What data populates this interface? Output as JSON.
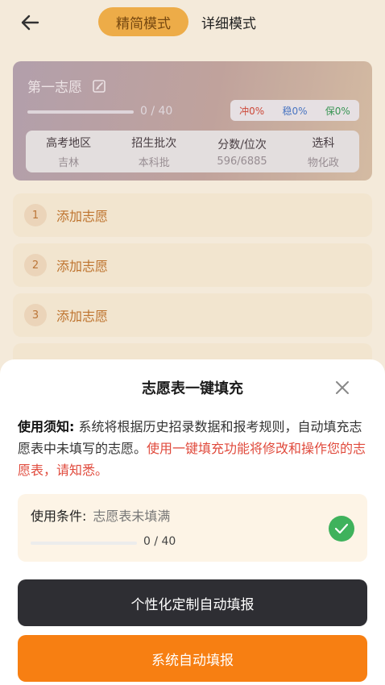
{
  "header": {
    "back_icon": "arrow-left-icon",
    "tabs": [
      {
        "label": "精简模式",
        "active": true
      },
      {
        "label": "详细模式",
        "active": false
      }
    ]
  },
  "volunteer_card": {
    "title": "第一志愿",
    "progress_text": "0 / 40",
    "progress_fraction": 0,
    "ratios": {
      "chong": "冲0%",
      "wen": "稳0%",
      "bao": "保0%"
    },
    "info": [
      {
        "label": "高考地区",
        "value": "吉林"
      },
      {
        "label": "招生批次",
        "value": "本科批"
      },
      {
        "label": "分数/位次",
        "value": "596/6885"
      },
      {
        "label": "选科",
        "value": "物化政"
      }
    ]
  },
  "slots": [
    {
      "num": "1",
      "label": "添加志愿"
    },
    {
      "num": "2",
      "label": "添加志愿"
    },
    {
      "num": "3",
      "label": "添加志愿"
    }
  ],
  "sheet": {
    "title": "志愿表一键填充",
    "notice_label": "使用须知:",
    "notice_text": "系统将根据历史招录数据和报考规则，自动填充志愿表中未填写的志愿。",
    "notice_warning": "使用一键填充功能将修改和操作您的志愿表，请知悉。",
    "condition": {
      "label": "使用条件:",
      "value": "志愿表未填满",
      "progress_text": "0 / 40",
      "progress_fraction": 0
    },
    "buttons": {
      "custom": "个性化定制自动填报",
      "auto": "系统自动填报"
    }
  },
  "colors": {
    "accent_orange": "#f77f12",
    "dark_button": "#2e2e33",
    "warning_red": "#e04a3c",
    "check_green": "#3fb25c"
  }
}
